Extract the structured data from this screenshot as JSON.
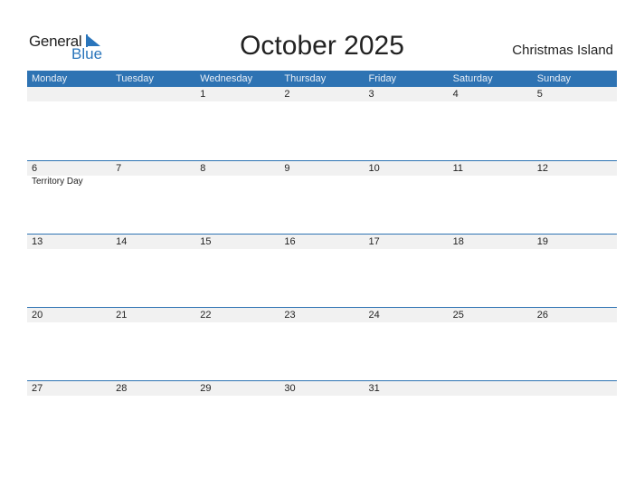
{
  "logo": {
    "general": "General",
    "blue": "Blue"
  },
  "title": "October 2025",
  "region": "Christmas Island",
  "weekdays": [
    "Monday",
    "Tuesday",
    "Wednesday",
    "Thursday",
    "Friday",
    "Saturday",
    "Sunday"
  ],
  "weeks": [
    {
      "days": [
        "",
        "",
        "1",
        "2",
        "3",
        "4",
        "5"
      ],
      "events": [
        "",
        "",
        "",
        "",
        "",
        "",
        ""
      ]
    },
    {
      "days": [
        "6",
        "7",
        "8",
        "9",
        "10",
        "11",
        "12"
      ],
      "events": [
        "Territory Day",
        "",
        "",
        "",
        "",
        "",
        ""
      ]
    },
    {
      "days": [
        "13",
        "14",
        "15",
        "16",
        "17",
        "18",
        "19"
      ],
      "events": [
        "",
        "",
        "",
        "",
        "",
        "",
        ""
      ]
    },
    {
      "days": [
        "20",
        "21",
        "22",
        "23",
        "24",
        "25",
        "26"
      ],
      "events": [
        "",
        "",
        "",
        "",
        "",
        "",
        ""
      ]
    },
    {
      "days": [
        "27",
        "28",
        "29",
        "30",
        "31",
        "",
        ""
      ],
      "events": [
        "",
        "",
        "",
        "",
        "",
        "",
        ""
      ]
    }
  ],
  "colors": {
    "accent": "#2e73b3",
    "strip": "#f1f1f1"
  }
}
